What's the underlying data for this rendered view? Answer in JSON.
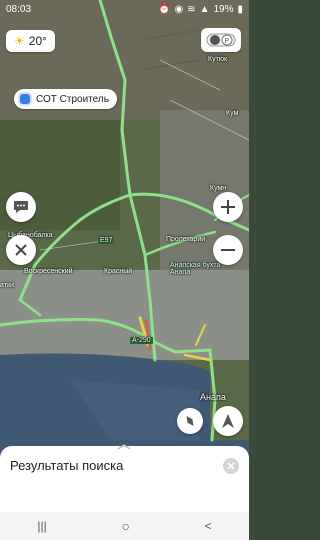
{
  "status_bar": {
    "time": "08:03",
    "battery_percent": "19%"
  },
  "weather": {
    "temperature": "20°"
  },
  "poi": {
    "label": "СОТ Строитель"
  },
  "map_labels": {
    "kutok": "Кутюк",
    "kum": "Кум",
    "kum2": "Кумн",
    "tsybanobalka": "Цыбанобалка",
    "voskresenskiy": "Воскресенский",
    "krasnyy": "Красный",
    "proletarskiy": "Пролетарий",
    "anapa_bay": "Анапская бухта\nАнапа",
    "katki": "атки",
    "anapa": "Анапа",
    "e97": "E97",
    "a290": "A-290"
  },
  "bottom_sheet": {
    "title": "Результаты поиска"
  },
  "nav": {
    "recents": "|||",
    "home": "○",
    "back": "<"
  },
  "colors": {
    "traffic_green": "#8fe08a",
    "traffic_yellow": "#e8d24a",
    "traffic_red": "#e05a3c",
    "sea": "#3f5873"
  }
}
